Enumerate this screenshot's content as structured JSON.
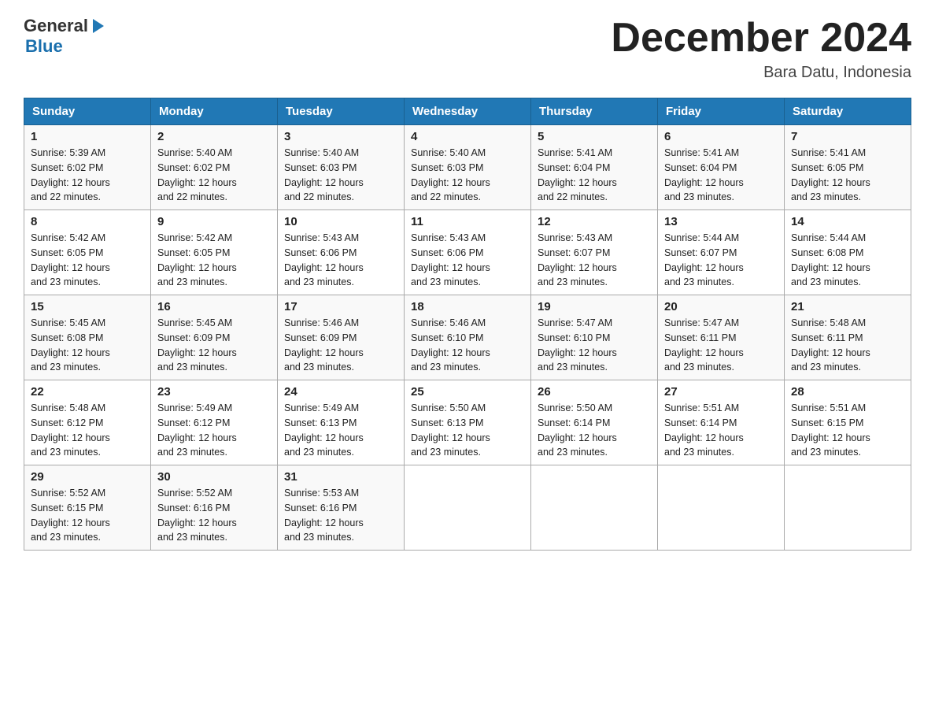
{
  "header": {
    "logo_general": "General",
    "logo_blue": "Blue",
    "title": "December 2024",
    "subtitle": "Bara Datu, Indonesia"
  },
  "weekdays": [
    "Sunday",
    "Monday",
    "Tuesday",
    "Wednesday",
    "Thursday",
    "Friday",
    "Saturday"
  ],
  "weeks": [
    [
      {
        "day": "1",
        "sunrise": "5:39 AM",
        "sunset": "6:02 PM",
        "daylight": "12 hours and 22 minutes."
      },
      {
        "day": "2",
        "sunrise": "5:40 AM",
        "sunset": "6:02 PM",
        "daylight": "12 hours and 22 minutes."
      },
      {
        "day": "3",
        "sunrise": "5:40 AM",
        "sunset": "6:03 PM",
        "daylight": "12 hours and 22 minutes."
      },
      {
        "day": "4",
        "sunrise": "5:40 AM",
        "sunset": "6:03 PM",
        "daylight": "12 hours and 22 minutes."
      },
      {
        "day": "5",
        "sunrise": "5:41 AM",
        "sunset": "6:04 PM",
        "daylight": "12 hours and 22 minutes."
      },
      {
        "day": "6",
        "sunrise": "5:41 AM",
        "sunset": "6:04 PM",
        "daylight": "12 hours and 23 minutes."
      },
      {
        "day": "7",
        "sunrise": "5:41 AM",
        "sunset": "6:05 PM",
        "daylight": "12 hours and 23 minutes."
      }
    ],
    [
      {
        "day": "8",
        "sunrise": "5:42 AM",
        "sunset": "6:05 PM",
        "daylight": "12 hours and 23 minutes."
      },
      {
        "day": "9",
        "sunrise": "5:42 AM",
        "sunset": "6:05 PM",
        "daylight": "12 hours and 23 minutes."
      },
      {
        "day": "10",
        "sunrise": "5:43 AM",
        "sunset": "6:06 PM",
        "daylight": "12 hours and 23 minutes."
      },
      {
        "day": "11",
        "sunrise": "5:43 AM",
        "sunset": "6:06 PM",
        "daylight": "12 hours and 23 minutes."
      },
      {
        "day": "12",
        "sunrise": "5:43 AM",
        "sunset": "6:07 PM",
        "daylight": "12 hours and 23 minutes."
      },
      {
        "day": "13",
        "sunrise": "5:44 AM",
        "sunset": "6:07 PM",
        "daylight": "12 hours and 23 minutes."
      },
      {
        "day": "14",
        "sunrise": "5:44 AM",
        "sunset": "6:08 PM",
        "daylight": "12 hours and 23 minutes."
      }
    ],
    [
      {
        "day": "15",
        "sunrise": "5:45 AM",
        "sunset": "6:08 PM",
        "daylight": "12 hours and 23 minutes."
      },
      {
        "day": "16",
        "sunrise": "5:45 AM",
        "sunset": "6:09 PM",
        "daylight": "12 hours and 23 minutes."
      },
      {
        "day": "17",
        "sunrise": "5:46 AM",
        "sunset": "6:09 PM",
        "daylight": "12 hours and 23 minutes."
      },
      {
        "day": "18",
        "sunrise": "5:46 AM",
        "sunset": "6:10 PM",
        "daylight": "12 hours and 23 minutes."
      },
      {
        "day": "19",
        "sunrise": "5:47 AM",
        "sunset": "6:10 PM",
        "daylight": "12 hours and 23 minutes."
      },
      {
        "day": "20",
        "sunrise": "5:47 AM",
        "sunset": "6:11 PM",
        "daylight": "12 hours and 23 minutes."
      },
      {
        "day": "21",
        "sunrise": "5:48 AM",
        "sunset": "6:11 PM",
        "daylight": "12 hours and 23 minutes."
      }
    ],
    [
      {
        "day": "22",
        "sunrise": "5:48 AM",
        "sunset": "6:12 PM",
        "daylight": "12 hours and 23 minutes."
      },
      {
        "day": "23",
        "sunrise": "5:49 AM",
        "sunset": "6:12 PM",
        "daylight": "12 hours and 23 minutes."
      },
      {
        "day": "24",
        "sunrise": "5:49 AM",
        "sunset": "6:13 PM",
        "daylight": "12 hours and 23 minutes."
      },
      {
        "day": "25",
        "sunrise": "5:50 AM",
        "sunset": "6:13 PM",
        "daylight": "12 hours and 23 minutes."
      },
      {
        "day": "26",
        "sunrise": "5:50 AM",
        "sunset": "6:14 PM",
        "daylight": "12 hours and 23 minutes."
      },
      {
        "day": "27",
        "sunrise": "5:51 AM",
        "sunset": "6:14 PM",
        "daylight": "12 hours and 23 minutes."
      },
      {
        "day": "28",
        "sunrise": "5:51 AM",
        "sunset": "6:15 PM",
        "daylight": "12 hours and 23 minutes."
      }
    ],
    [
      {
        "day": "29",
        "sunrise": "5:52 AM",
        "sunset": "6:15 PM",
        "daylight": "12 hours and 23 minutes."
      },
      {
        "day": "30",
        "sunrise": "5:52 AM",
        "sunset": "6:16 PM",
        "daylight": "12 hours and 23 minutes."
      },
      {
        "day": "31",
        "sunrise": "5:53 AM",
        "sunset": "6:16 PM",
        "daylight": "12 hours and 23 minutes."
      },
      null,
      null,
      null,
      null
    ]
  ]
}
